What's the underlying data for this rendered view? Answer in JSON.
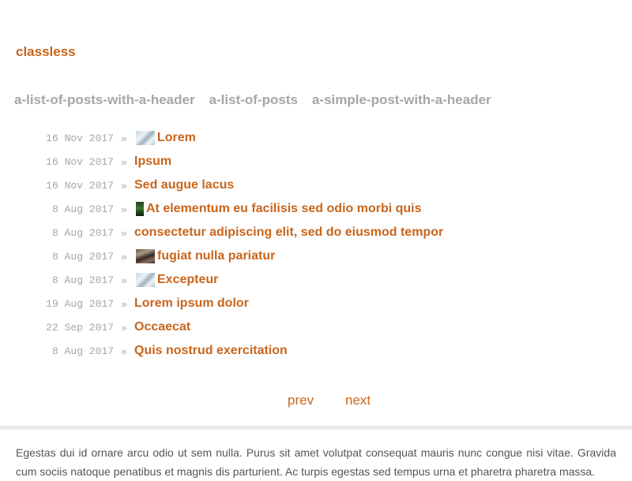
{
  "site": {
    "title": "classless"
  },
  "nav": {
    "items": [
      {
        "label": "a-list-of-posts-with-a-header"
      },
      {
        "label": "a-list-of-posts"
      },
      {
        "label": "a-simple-post-with-a-header"
      }
    ]
  },
  "posts": {
    "separator": "»",
    "items": [
      {
        "date": "16 Nov 2017",
        "title": "Lorem",
        "thumb": "snow-image"
      },
      {
        "date": "16 Nov 2017",
        "title": "Ipsum",
        "thumb": ""
      },
      {
        "date": "16 Nov 2017",
        "title": "Sed augue lacus",
        "thumb": ""
      },
      {
        "date": "8 Aug 2017",
        "title": "At elementum eu facilisis sed odio morbi quis",
        "thumb": "forest-image"
      },
      {
        "date": "8 Aug 2017",
        "title": "consectetur adipiscing elit, sed do eiusmod tempor",
        "thumb": ""
      },
      {
        "date": "8 Aug 2017",
        "title": "fugiat nulla pariatur",
        "thumb": "rocks-image"
      },
      {
        "date": "8 Aug 2017",
        "title": "Excepteur",
        "thumb": "snow-image"
      },
      {
        "date": "19 Aug 2017",
        "title": "Lorem ipsum dolor",
        "thumb": ""
      },
      {
        "date": "22 Sep 2017",
        "title": "Occaecat",
        "thumb": ""
      },
      {
        "date": "8 Aug 2017",
        "title": "Quis nostrud exercitation",
        "thumb": ""
      }
    ]
  },
  "pager": {
    "prev_label": "prev",
    "next_label": "next"
  },
  "footer": {
    "text": "Egestas dui id ornare arcu odio ut sem nulla. Purus sit amet volutpat consequat mauris nunc congue nisi vitae. Gravida cum sociis natoque penatibus et magnis dis parturient. Ac turpis egestas sed tempus urna et pharetra pharetra massa."
  },
  "colors": {
    "accent": "#c8651b",
    "muted": "#a6a6a6",
    "body_text": "#555555",
    "divider": "#ebebeb"
  }
}
